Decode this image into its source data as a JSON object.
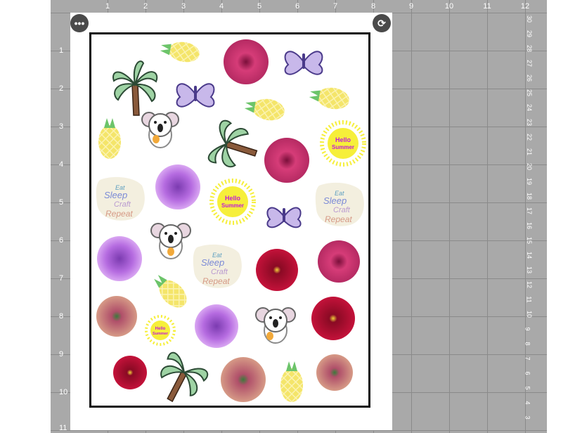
{
  "ruler": {
    "top_inches": [
      "1",
      "2",
      "3",
      "4",
      "5",
      "6",
      "7",
      "8",
      "9",
      "10",
      "11",
      "12"
    ],
    "left_inches": [
      "1",
      "2",
      "3",
      "4",
      "5",
      "6",
      "7",
      "8",
      "9",
      "10",
      "11"
    ],
    "right_inches": [
      "30",
      "29",
      "28",
      "27",
      "26",
      "25",
      "24",
      "23",
      "22",
      "21",
      "20",
      "19",
      "18",
      "17",
      "16",
      "15",
      "14",
      "13",
      "12",
      "11",
      "10",
      "9",
      "8",
      "7",
      "6",
      "5",
      "4",
      "3"
    ]
  },
  "controls": {
    "more_icon": "•••",
    "rotate_icon": "⟳"
  },
  "stickers": {
    "sun_text_line1": "Hello",
    "sun_text_line2": "Summer",
    "quote_line1": "Eat",
    "quote_line2": "Sleep",
    "quote_line3": "Craft",
    "quote_line4": "Repeat"
  },
  "colors": {
    "mat": "#a9a9a9",
    "hibiscus_pink": "#d63c78",
    "hibiscus_red": "#c4123a",
    "dahlia_purple": "#b56be0",
    "dahlia_peach": "#c88478",
    "pineapple": "#f4e56a",
    "sun": "#f6ef3a",
    "sun_text": "#c21bd6",
    "butterfly": "#9d8ad3"
  }
}
